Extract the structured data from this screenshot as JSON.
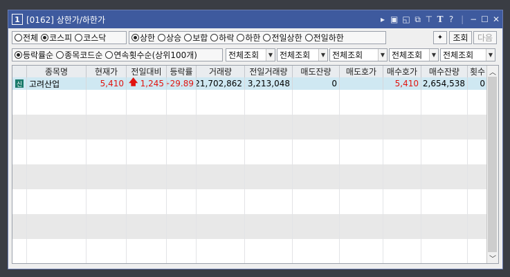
{
  "window": {
    "number": "1",
    "title": "[0162] 상한가/하한가",
    "icons": [
      "arrow-right-icon",
      "layout-icon",
      "window-icon",
      "restore-icon",
      "pin-icon",
      "font-icon",
      "help-icon",
      "minimize-icon",
      "maximize-icon",
      "close-icon"
    ]
  },
  "market_filter": {
    "options": [
      "전체",
      "코스피",
      "코스닥"
    ],
    "selected": "코스피"
  },
  "price_filter": {
    "options": [
      "상한",
      "상승",
      "보합",
      "하락",
      "하한",
      "전일상한",
      "전일하한"
    ],
    "selected": "상한"
  },
  "buttons": {
    "query": "조회",
    "next": "다음"
  },
  "sort_filter": {
    "options": [
      "등락률순",
      "종목코드순",
      "연속횟수순(상위100개)"
    ],
    "selected": "등락률순"
  },
  "dropdowns": [
    "전체조회",
    "전체조회",
    "전체조회",
    "전체조회",
    "전체조회"
  ],
  "table": {
    "columns": [
      "종목명",
      "현재가",
      "전일대비",
      "등락률",
      "거래량",
      "전일거래량",
      "매도잔량",
      "매도호가",
      "매수호가",
      "매수잔량",
      "횟수"
    ],
    "rows": [
      {
        "badge": "신",
        "name": "고려산업",
        "price": "5,410",
        "change": "1,245",
        "rate": "+29.89",
        "volume": "21,702,862",
        "prev_volume": "3,213,048",
        "ask_qty": "0",
        "ask_price": "",
        "bid_price": "5,410",
        "bid_qty": "2,654,538",
        "count": "0"
      }
    ]
  },
  "colors": {
    "title_bg": "#3e5a9e",
    "up_red": "#e0140f",
    "selected_row": "#cfe8f2"
  }
}
